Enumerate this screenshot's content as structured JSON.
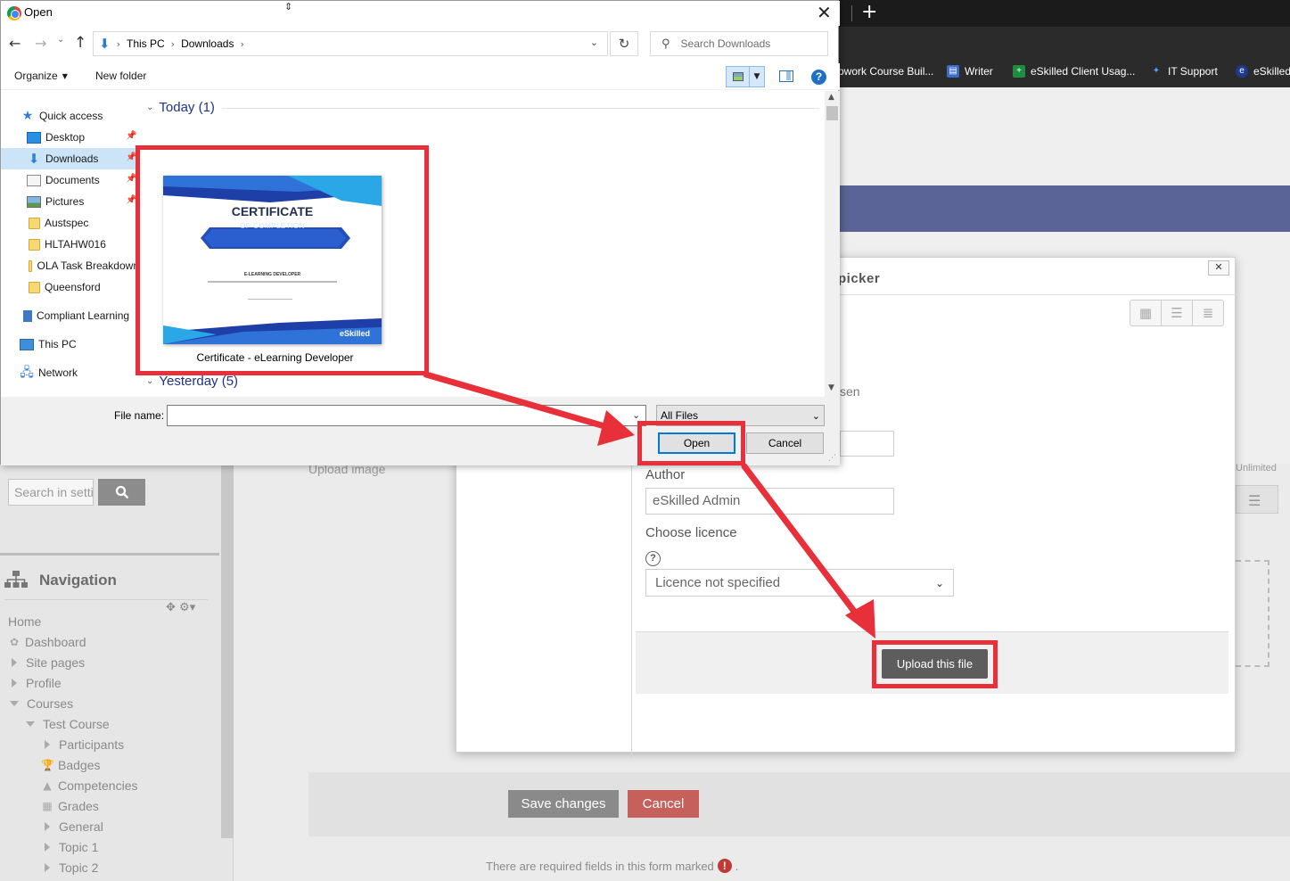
{
  "browser": {
    "bookmarks": [
      {
        "label": "pwork Course Buil...",
        "icon": "bookmark-icon"
      },
      {
        "label": "Writer",
        "icon": "writer-icon"
      },
      {
        "label": "eSkilled Client Usag...",
        "icon": "sheets-icon"
      },
      {
        "label": "IT Support",
        "icon": "it-support-icon"
      },
      {
        "label": "eSkilled",
        "icon": "eskilled-icon"
      }
    ]
  },
  "moodle": {
    "upload_image_label": "Upload image",
    "unlimited": "Unlimited",
    "search_placeholder": "Search in settings",
    "navigation": {
      "title": "Navigation",
      "items": [
        {
          "label": "Home"
        },
        {
          "label": "Dashboard"
        },
        {
          "label": "Site pages"
        },
        {
          "label": "Profile"
        },
        {
          "label": "Courses"
        },
        {
          "label": "Test Course"
        },
        {
          "label": "Participants"
        },
        {
          "label": "Badges"
        },
        {
          "label": "Competencies"
        },
        {
          "label": "Grades"
        },
        {
          "label": "General"
        },
        {
          "label": "Topic 1"
        },
        {
          "label": "Topic 2"
        }
      ]
    },
    "save_changes": "Save changes",
    "cancel": "Cancel",
    "required_note": "There are required fields in this form marked",
    "required_note_end": "."
  },
  "file_picker": {
    "title": "picker",
    "chosen_fragment": "sen",
    "author_label": "Author",
    "author_value": "eSkilled Admin",
    "licence_label": "Choose licence",
    "licence_value": "Licence not specified",
    "upload_button": "Upload this file",
    "close": "✕"
  },
  "open_dialog": {
    "title": "Open",
    "address": {
      "segments": [
        "This PC",
        "Downloads"
      ]
    },
    "search_placeholder": "Search Downloads",
    "toolbar": {
      "organize": "Organize",
      "new_folder": "New folder"
    },
    "tree": [
      {
        "label": "Quick access",
        "icon": "star"
      },
      {
        "label": "Desktop",
        "icon": "desktop",
        "pinned": true
      },
      {
        "label": "Downloads",
        "icon": "download",
        "pinned": true,
        "selected": true
      },
      {
        "label": "Documents",
        "icon": "documents",
        "pinned": true
      },
      {
        "label": "Pictures",
        "icon": "pictures",
        "pinned": true
      },
      {
        "label": "Austspec",
        "icon": "folder"
      },
      {
        "label": "HLTAHW016",
        "icon": "folder"
      },
      {
        "label": "OLA Task Breakdown",
        "icon": "folder"
      },
      {
        "label": "Queensford",
        "icon": "folder"
      },
      {
        "label": "Compliant Learning",
        "icon": "building"
      },
      {
        "label": "This PC",
        "icon": "pc"
      },
      {
        "label": "Network",
        "icon": "network"
      }
    ],
    "groups": [
      {
        "label": "Today (1)"
      },
      {
        "label": "Yesterday (5)"
      }
    ],
    "file": {
      "name": "Certificate - eLearning Developer",
      "thumb_title": "CERTIFICATE",
      "thumb_subtitle": "OF COMPLETION",
      "thumb_role": "E-LEARNING DEVELOPER",
      "thumb_brand": "eSkilled"
    },
    "file_name_label": "File name:",
    "file_name_value": "",
    "file_type": "All Files",
    "open_button": "Open",
    "cancel_button": "Cancel"
  },
  "colors": {
    "highlight": "#e8303a",
    "moodle_header": "#5b6496",
    "save_button": "#8a8a8a",
    "cancel_button": "#c6605b",
    "upload_button": "#5d5d5d",
    "open_button_border": "#0078d7"
  }
}
